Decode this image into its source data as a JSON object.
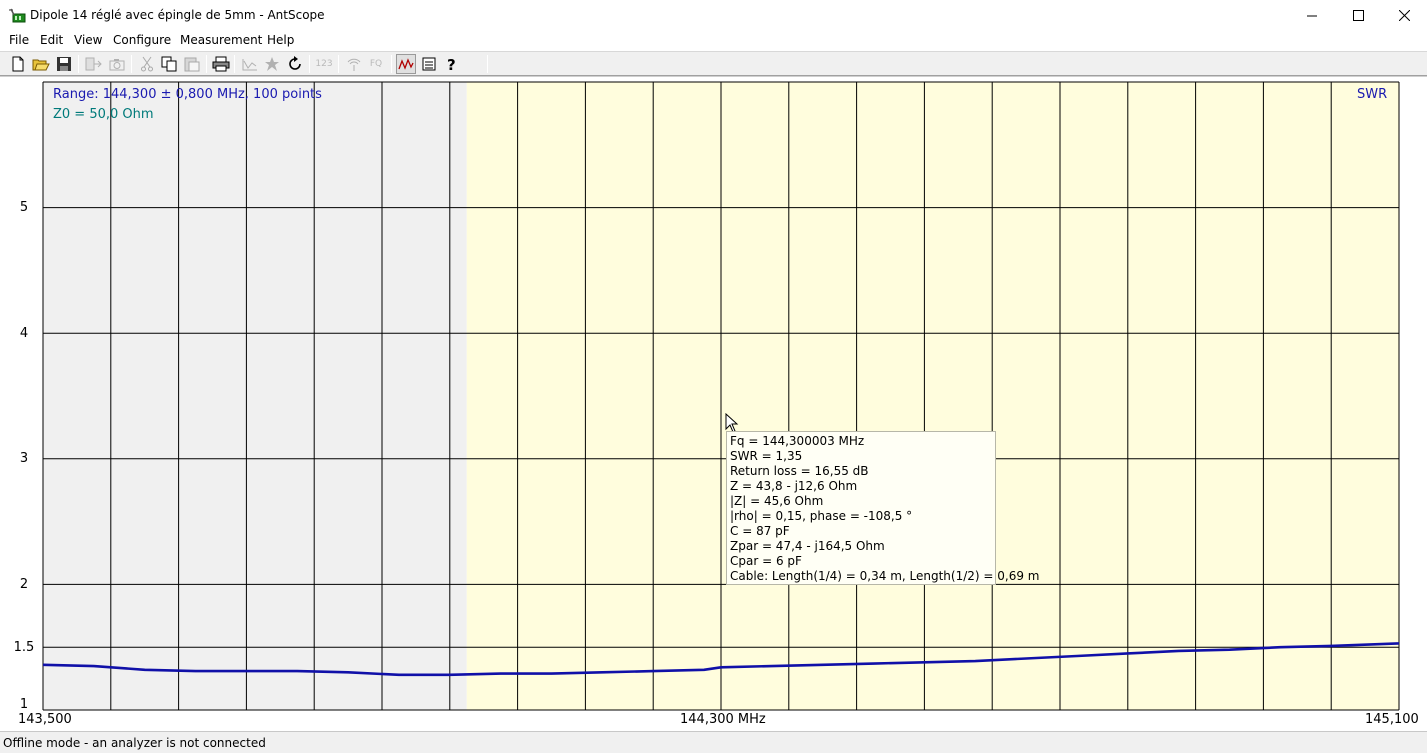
{
  "window": {
    "title": "Dipole 14 réglé avec épingle de 5mm - AntScope"
  },
  "menu": {
    "items": [
      {
        "label": "File"
      },
      {
        "label": "Edit"
      },
      {
        "label": "View"
      },
      {
        "label": "Configure"
      },
      {
        "label": "Measurement"
      },
      {
        "label": "Help"
      }
    ]
  },
  "toolbar": {
    "buttons": [
      {
        "icon": "new-file-icon",
        "enabled": true
      },
      {
        "icon": "open-folder-icon",
        "enabled": true
      },
      {
        "icon": "save-icon",
        "enabled": true
      },
      {
        "icon": "export-icon",
        "enabled": false
      },
      {
        "icon": "camera-icon",
        "enabled": false
      },
      {
        "icon": "cut-icon",
        "enabled": false
      },
      {
        "icon": "copy-icon",
        "enabled": true
      },
      {
        "icon": "paste-icon",
        "enabled": false
      },
      {
        "icon": "print-icon",
        "enabled": true
      },
      {
        "icon": "scan-icon",
        "enabled": false
      },
      {
        "icon": "star-icon",
        "enabled": false
      },
      {
        "icon": "refresh-icon",
        "enabled": true
      },
      {
        "icon": "numbers-icon",
        "enabled": false,
        "text": "123"
      },
      {
        "icon": "antenna-icon",
        "enabled": false
      },
      {
        "icon": "frequency-icon",
        "enabled": false,
        "text": "FQ"
      },
      {
        "icon": "swr-graph-icon",
        "enabled": true,
        "pressed": true
      },
      {
        "icon": "table-icon",
        "enabled": true
      },
      {
        "icon": "help-icon",
        "enabled": true
      }
    ]
  },
  "plot": {
    "range_text": "Range: 144,300 ± 0,800 MHz, 100 points",
    "z0_text": "Z0 = 50,0 Ohm",
    "corner_label": "SWR",
    "colors": {
      "grid": "#000000",
      "outside_band": "#f0f0f0",
      "inside_band": "#fffddd",
      "trace": "#1010a8"
    }
  },
  "tooltip": {
    "lines": [
      "Fq = 144,300003 MHz",
      "SWR = 1,35",
      "Return loss = 16,55 dB",
      "Z = 43,8 - j12,6 Ohm",
      "|Z| = 45,6 Ohm",
      "|rho| = 0,15, phase = -108,5 °",
      "C = 87 pF",
      "Zpar = 47,4 - j164,5 Ohm",
      "Cpar = 6 pF",
      "Cable: Length(1/4) = 0,34 m, Length(1/2) = 0,69 m"
    ]
  },
  "status": {
    "text": "Offline mode - an analyzer is not connected"
  },
  "chart_data": {
    "type": "line",
    "title": "SWR",
    "xlabel": "",
    "ylabel": "",
    "x_ticks": [
      "143,500",
      "144,300 MHz",
      "145,100"
    ],
    "xlim": [
      143.5,
      145.1
    ],
    "ylim": [
      1,
      6
    ],
    "y_ticks": [
      "1",
      "1.5",
      "2",
      "3",
      "4",
      "5"
    ],
    "y_tick_values": [
      1,
      1.5,
      2,
      3,
      4,
      5
    ],
    "band_shading": {
      "outside_until_mhz": 144.0
    },
    "series": [
      {
        "x": [
          143.5,
          143.56,
          143.62,
          143.68,
          143.74,
          143.8,
          143.86,
          143.92,
          143.98,
          144.04,
          144.1,
          144.16,
          144.22,
          144.28,
          144.3,
          144.36,
          144.42,
          144.48,
          144.54,
          144.6,
          144.66,
          144.72,
          144.78,
          144.84,
          144.9,
          144.96,
          145.02,
          145.1
        ],
        "y": [
          1.36,
          1.35,
          1.32,
          1.31,
          1.31,
          1.31,
          1.3,
          1.28,
          1.28,
          1.29,
          1.29,
          1.3,
          1.31,
          1.32,
          1.34,
          1.35,
          1.36,
          1.37,
          1.38,
          1.39,
          1.41,
          1.43,
          1.45,
          1.47,
          1.48,
          1.5,
          1.51,
          1.53
        ]
      }
    ]
  }
}
